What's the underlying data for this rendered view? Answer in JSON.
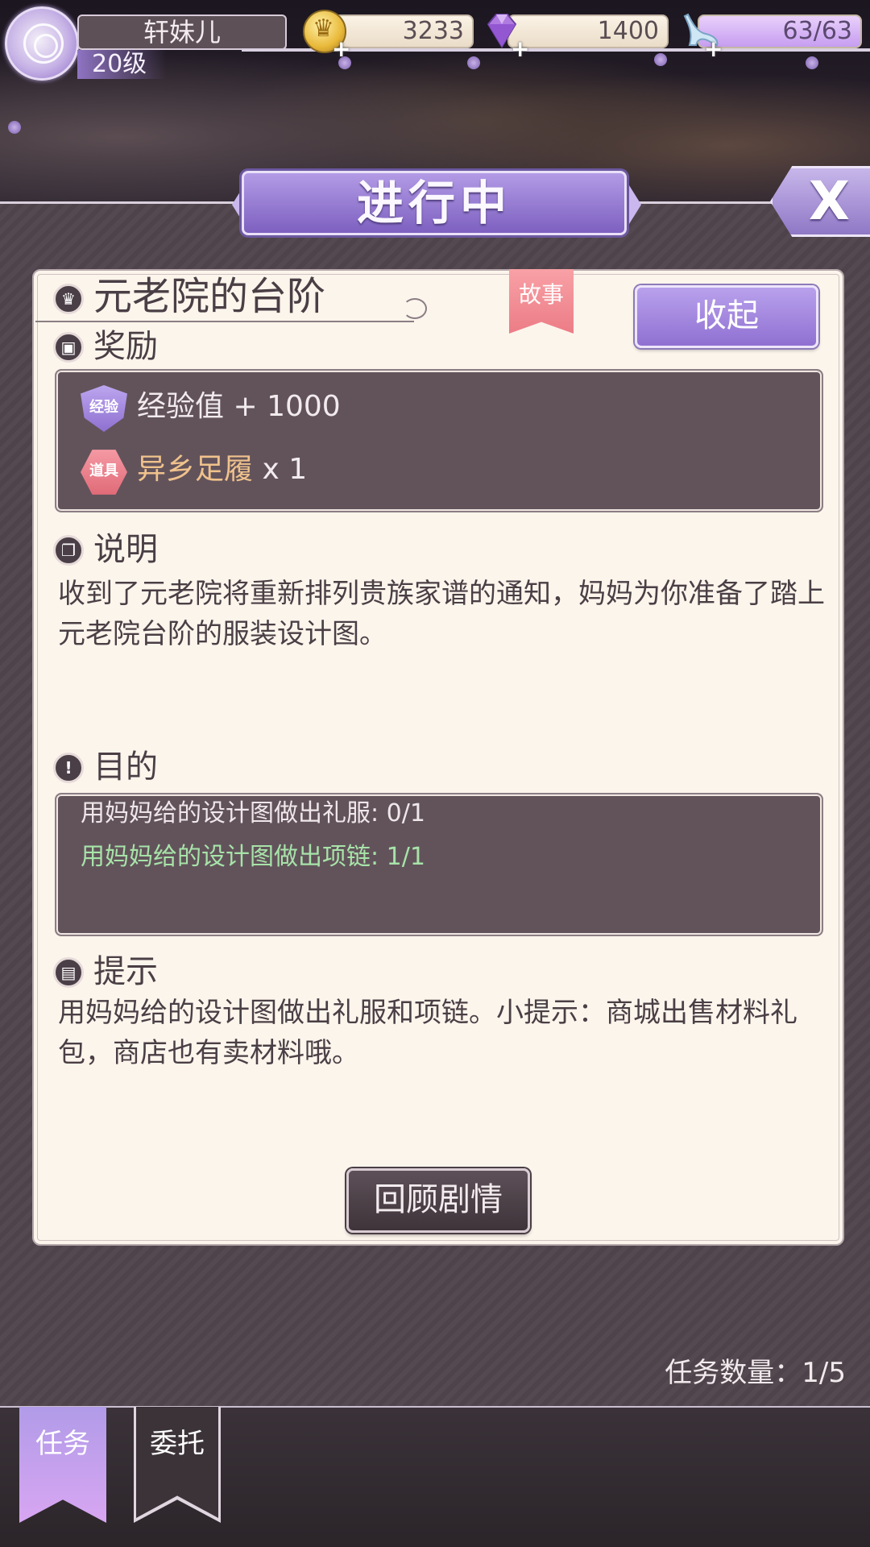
{
  "player": {
    "name": "轩妹儿",
    "level": "20级"
  },
  "resources": {
    "gold": "3233",
    "gems": "1400",
    "stamina": "63/63",
    "gold_icon": "gold-coin-icon",
    "gem_icon": "diamond-icon",
    "stamina_icon": "glass-slipper-icon"
  },
  "header": {
    "title": "进行中",
    "close_label": "X"
  },
  "quest": {
    "title": "元老院的台阶",
    "tag": "故事",
    "collapse_label": "收起",
    "sections": {
      "reward": "奖励",
      "description": "说明",
      "objective": "目的",
      "hint": "提示"
    },
    "rewards": [
      {
        "badge": "经验",
        "label": "经验值",
        "amount": "+ 1000"
      },
      {
        "badge": "道具",
        "label": "异乡足履",
        "amount": "x 1"
      }
    ],
    "description": "收到了元老院将重新排列贵族家谱的通知，妈妈为你准备了踏上元老院台阶的服装设计图。",
    "objectives": [
      {
        "text": "用妈妈给的设计图做出礼服: 0/1",
        "completed": false
      },
      {
        "text": "用妈妈给的设计图做出项链: 1/1",
        "completed": true
      }
    ],
    "hint": "用妈妈给的设计图做出礼服和项链。小提示：商城出售材料礼包，商店也有卖材料哦。",
    "review_label": "回顾剧情"
  },
  "task_count": "任务数量：1/5",
  "tabs": [
    {
      "label": "任务",
      "active": true
    },
    {
      "label": "委托",
      "active": false
    }
  ],
  "colors": {
    "accent_purple": "#8f70d2",
    "card_bg": "#fcf5ec",
    "dark_panel": "#62535b",
    "completed_green": "#a7e3a8",
    "item_gold": "#f0c28c",
    "story_tag_pink": "#ec7c86"
  }
}
